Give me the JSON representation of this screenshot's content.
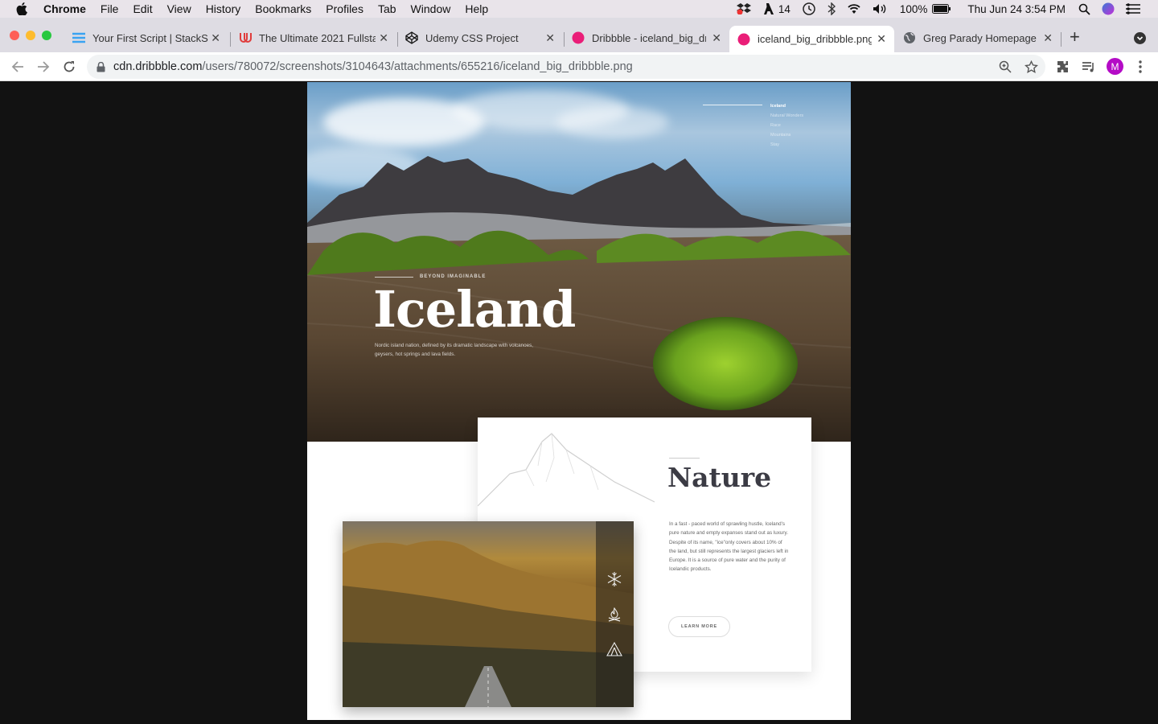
{
  "menubar": {
    "app_name": "Chrome",
    "menus": [
      "File",
      "Edit",
      "View",
      "History",
      "Bookmarks",
      "Profiles",
      "Tab",
      "Window",
      "Help"
    ],
    "status": {
      "adobe_count": "14",
      "battery": "100%",
      "datetime": "Thu Jun 24  3:54 PM"
    }
  },
  "tabs": [
    {
      "title": "Your First Script | StackS",
      "favicon": "stackskills-icon",
      "favicon_color": "#3aa3f2"
    },
    {
      "title": "The Ultimate 2021 Fullsta",
      "favicon": "udemy-icon",
      "favicon_color": "#e03c3c"
    },
    {
      "title": "Udemy CSS Project",
      "favicon": "codepen-icon",
      "favicon_color": "#111111"
    },
    {
      "title": "Dribbble - iceland_big_dr",
      "favicon": "dribbble-icon",
      "favicon_color": "#ea1e78"
    },
    {
      "title": "iceland_big_dribbble.png",
      "favicon": "dribbble-icon",
      "favicon_color": "#ea1e78",
      "active": true
    },
    {
      "title": "Greg Parady Homepage",
      "favicon": "globe-icon",
      "favicon_color": "#5f6368"
    }
  ],
  "toolbar": {
    "url_host": "cdn.dribbble.com",
    "url_path": "/users/780072/screenshots/3104643/attachments/655216/iceland_big_dribbble.png",
    "avatar_letter": "M"
  },
  "hero": {
    "nav": [
      "Iceland",
      "Natural Wonders",
      "Race",
      "Mountains",
      "Stay"
    ],
    "eyebrow": "BEYOND IMAGINABLE",
    "title": "Iceland",
    "description": "Nordic island nation, defined by its dramatic landscape with volcanoes, geysers, hot springs and lava fields."
  },
  "nature": {
    "title": "Nature",
    "text": "In a fast - paced world of sprawling hustle, Iceland's pure nature and empty expanses stand out as luxury. Despite of its name, \"ice\"only covers about 10% of the land, but still represents the largest glaciers left in Europe. It is a source of pure water and the purity of Icelandic products.",
    "button": "LEARN MORE"
  },
  "colors": {
    "close_red": "#fe5f57",
    "minimize_yellow": "#febc2e",
    "maximize_green": "#28c840",
    "avatar_purple": "#b40bc6"
  }
}
